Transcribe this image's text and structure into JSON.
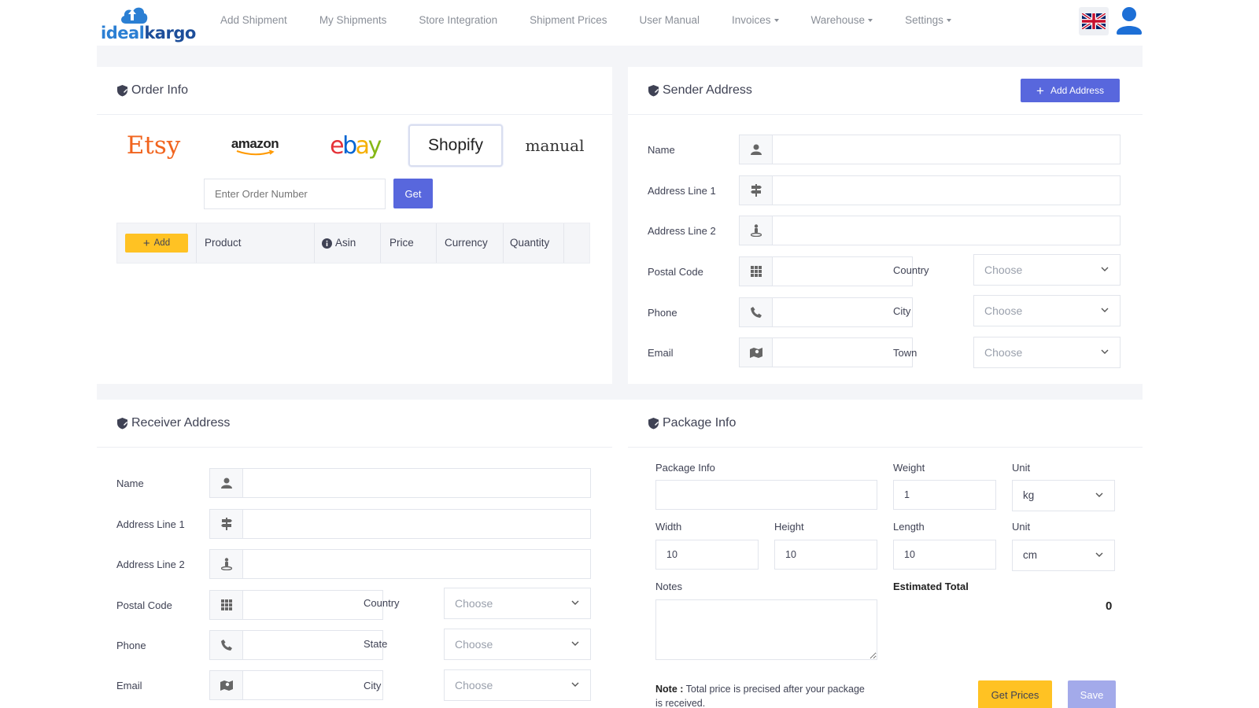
{
  "brand": {
    "part1": "ideal",
    "part2": "kargo"
  },
  "nav": {
    "items": [
      {
        "label": "Add Shipment"
      },
      {
        "label": "My Shipments"
      },
      {
        "label": "Store Integration"
      },
      {
        "label": "Shipment Prices"
      },
      {
        "label": "User Manual"
      },
      {
        "label": "Invoices",
        "dropdown": true
      },
      {
        "label": "Warehouse",
        "dropdown": true
      },
      {
        "label": "Settings",
        "dropdown": true
      }
    ]
  },
  "order_info": {
    "title": "Order Info",
    "stores": {
      "etsy": "Etsy",
      "amazon": "amazon",
      "ebay_e": "e",
      "ebay_b": "b",
      "ebay_a": "a",
      "ebay_y": "y",
      "shopify": "Shopify",
      "manual": "manual"
    },
    "active_store": "Shopify",
    "order_number_placeholder": "Enter Order Number",
    "get_label": "Get",
    "add_label": "Add",
    "columns": {
      "product": "Product",
      "asin": "Asin",
      "price": "Price",
      "currency": "Currency",
      "quantity": "Quantity"
    }
  },
  "sender": {
    "title": "Sender Address",
    "add_address_label": "Add Address",
    "labels": {
      "name": "Name",
      "address1": "Address Line 1",
      "address2": "Address Line 2",
      "postal": "Postal Code",
      "phone": "Phone",
      "email": "Email",
      "country": "Country",
      "city": "City",
      "town": "Town"
    },
    "choose": "Choose"
  },
  "receiver": {
    "title": "Receiver Address",
    "labels": {
      "name": "Name",
      "address1": "Address Line 1",
      "address2": "Address Line 2",
      "postal": "Postal Code",
      "phone": "Phone",
      "email": "Email",
      "country": "Country",
      "state": "State",
      "city": "City"
    },
    "choose": "Choose"
  },
  "package": {
    "title": "Package Info",
    "labels": {
      "package_info": "Package Info",
      "weight": "Weight",
      "unit": "Unit",
      "width": "Width",
      "height": "Height",
      "length": "Length",
      "notes": "Notes",
      "estimated_total": "Estimated Total"
    },
    "values": {
      "weight": "1",
      "weight_unit": "kg",
      "width": "10",
      "height": "10",
      "length": "10",
      "dim_unit": "cm",
      "estimated_total": "0"
    },
    "note_prefix": "Note :",
    "note_text": " Total price is precised after your package is received.",
    "get_prices_label": "Get Prices",
    "save_label": "Save"
  },
  "colors": {
    "primary": "#5867dd",
    "yellow": "#ffc223",
    "band": "#f4f5f8",
    "border": "#e2e5ec"
  }
}
